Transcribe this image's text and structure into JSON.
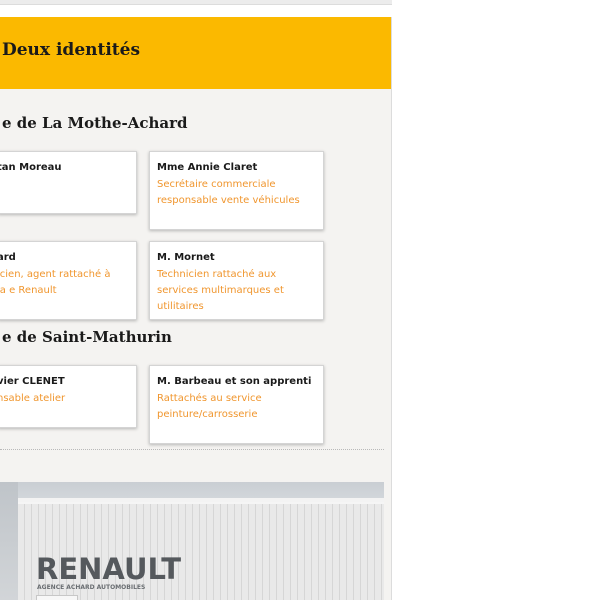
{
  "panel": {
    "title": "Deux identités",
    "colors": {
      "header": "#fbb900",
      "role_text": "#f0962e",
      "panel_bg": "#f4f3f1"
    }
  },
  "sections": [
    {
      "heading": "e de La Mothe-Achard",
      "cards": [
        {
          "name": "tan Moreau",
          "role": ""
        },
        {
          "name": "Mme Annie Claret",
          "role": "Secrétaire commerciale responsable vente véhicules"
        },
        {
          "name": "ard",
          "role": "icien, agent rattaché à la e Renault"
        },
        {
          "name": "M. Mornet",
          "role": "Technicien rattaché aux services multimarques et utilitaires"
        }
      ]
    },
    {
      "heading": "e de Saint-Mathurin",
      "cards": [
        {
          "name": "vier CLENET",
          "role": "nsable atelier"
        },
        {
          "name": "M. Barbeau et son apprenti",
          "role": "Rattachés au service peinture/carrosserie"
        }
      ]
    }
  ],
  "photo": {
    "brand": "RENAULT",
    "agency": "AGENCE ACHARD AUTOMOBILES"
  }
}
